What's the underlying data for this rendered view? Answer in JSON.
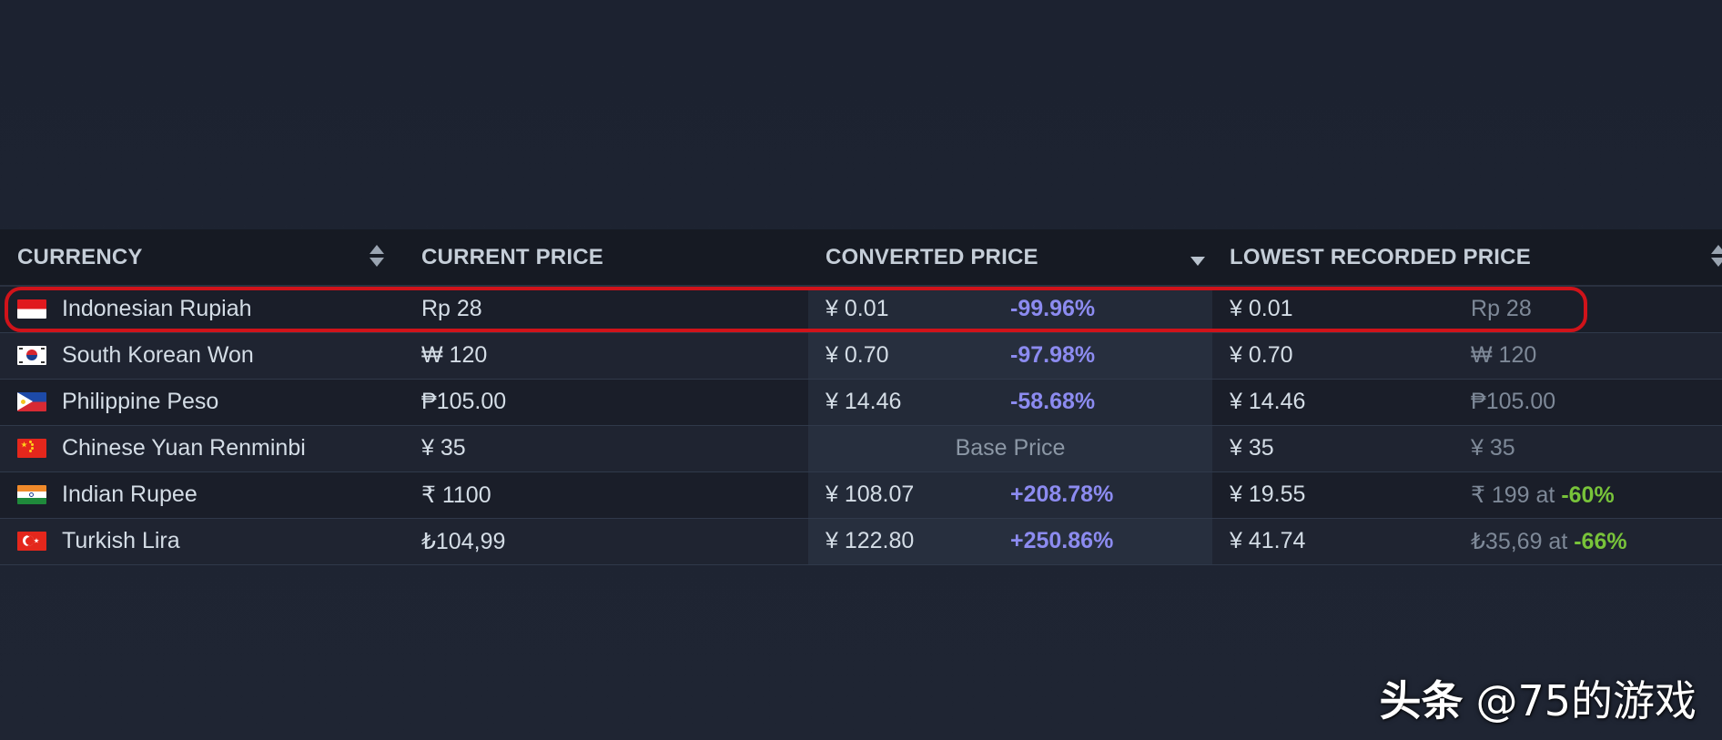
{
  "table": {
    "headers": {
      "currency": "CURRENCY",
      "current_price": "CURRENT PRICE",
      "converted_price": "CONVERTED PRICE",
      "lowest_recorded_price": "LOWEST RECORDED PRICE"
    },
    "sort": {
      "active_column": "converted_price",
      "direction": "descending"
    },
    "rows": [
      {
        "flag": "indonesia-flag-icon",
        "currency": "Indonesian Rupiah",
        "current_price": "Rp 28",
        "converted_price": "¥ 0.01",
        "change": "-99.96%",
        "lowest_converted": "¥ 0.01",
        "lowest_original": "Rp 28",
        "highlighted": true
      },
      {
        "flag": "south-korea-flag-icon",
        "currency": "South Korean Won",
        "current_price": "₩ 120",
        "converted_price": "¥ 0.70",
        "change": "-97.98%",
        "lowest_converted": "¥ 0.70",
        "lowest_original": "₩ 120"
      },
      {
        "flag": "philippines-flag-icon",
        "currency": "Philippine Peso",
        "current_price": "₱105.00",
        "converted_price": "¥ 14.46",
        "change": "-58.68%",
        "lowest_converted": "¥ 14.46",
        "lowest_original": "₱105.00"
      },
      {
        "flag": "china-flag-icon",
        "currency": "Chinese Yuan Renminbi",
        "current_price": "¥ 35",
        "base_price_label": "Base Price",
        "lowest_converted": "¥ 35",
        "lowest_original": "¥ 35"
      },
      {
        "flag": "india-flag-icon",
        "currency": "Indian Rupee",
        "current_price": "₹ 1100",
        "converted_price": "¥ 108.07",
        "change": "+208.78%",
        "lowest_converted": "¥ 19.55",
        "lowest_original": "₹ 199 at ",
        "lowest_discount": "-60%"
      },
      {
        "flag": "turkey-flag-icon",
        "currency": "Turkish Lira",
        "current_price": "₺104,99",
        "converted_price": "¥ 122.80",
        "change": "+250.86%",
        "lowest_converted": "¥ 41.74",
        "lowest_original": "₺35,69 at ",
        "lowest_discount": "-66%"
      }
    ]
  },
  "colors": {
    "background": "#1c2230",
    "header_bg": "#161a23",
    "percent_text": "#8c8bf0",
    "discount_text": "#78c33a",
    "highlight_ring": "#d0131a"
  },
  "watermark": {
    "brand": "头条",
    "handle": "@75的游戏"
  }
}
